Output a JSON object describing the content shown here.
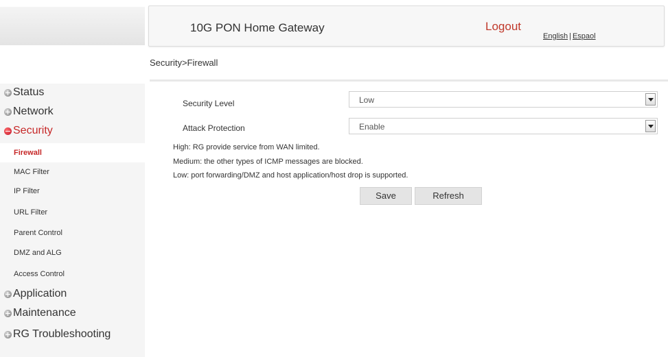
{
  "header": {
    "title": "10G PON Home Gateway",
    "logout": "Logout",
    "lang_english": "English",
    "lang_separator": "|",
    "lang_espanol": "Espaol"
  },
  "breadcrumb": "Security>Firewall",
  "sidebar": {
    "top_items": [
      {
        "label": "Status",
        "icon": "plus-bullet-icon",
        "expanded": false
      },
      {
        "label": "Network",
        "icon": "plus-bullet-icon",
        "expanded": false
      },
      {
        "label": "Security",
        "icon": "minus-bullet-icon",
        "expanded": true
      },
      {
        "label": "Application",
        "icon": "plus-bullet-icon",
        "expanded": false
      },
      {
        "label": "Maintenance",
        "icon": "plus-bullet-icon",
        "expanded": false
      },
      {
        "label": "RG Troubleshooting",
        "icon": "plus-bullet-icon",
        "expanded": false
      }
    ],
    "security_items": [
      {
        "label": "Firewall",
        "active": true
      },
      {
        "label": "MAC Filter",
        "active": false
      },
      {
        "label": "IP Filter",
        "active": false
      },
      {
        "label": "URL Filter",
        "active": false
      },
      {
        "label": "Parent Control",
        "active": false
      },
      {
        "label": "DMZ and ALG",
        "active": false
      },
      {
        "label": "Access Control",
        "active": false
      }
    ]
  },
  "form": {
    "security_level": {
      "label": "Security Level",
      "value": "Low"
    },
    "attack_protection": {
      "label": "Attack Protection",
      "value": "Enable"
    }
  },
  "notes": [
    "High: RG provide service from WAN limited.",
    "Medium: the other types of ICMP messages are blocked.",
    "Low: port forwarding/DMZ and host application/host drop is supported."
  ],
  "buttons": {
    "save": "Save",
    "refresh": "Refresh"
  },
  "colors": {
    "accent_red": "#c62828",
    "logout_red": "#c0392b",
    "sidebar_bg": "#f5f5f5",
    "button_bg": "#e4e4e4"
  }
}
